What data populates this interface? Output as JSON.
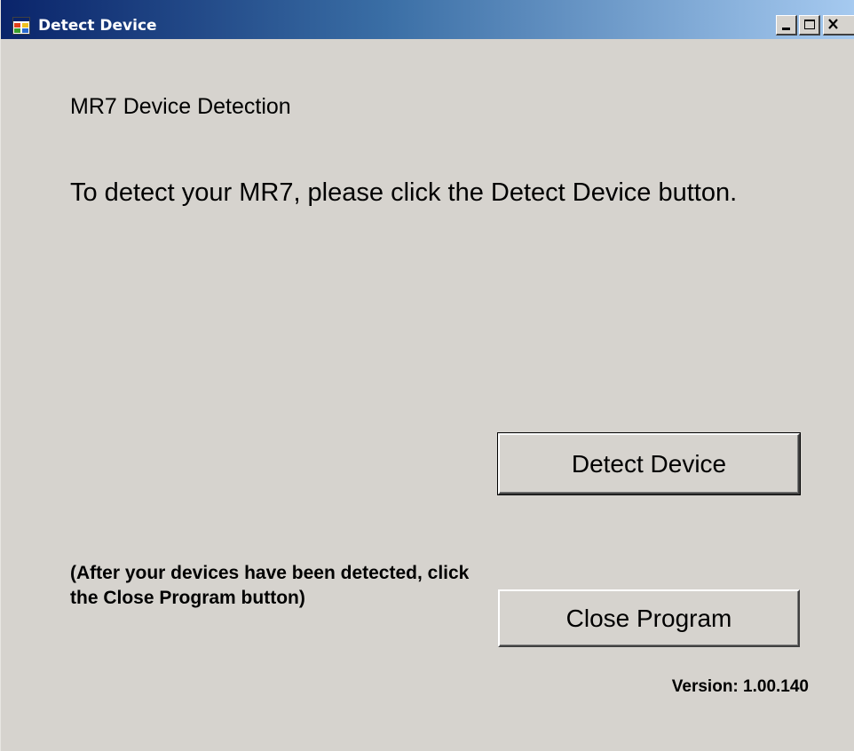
{
  "window": {
    "title": "Detect Device",
    "icon": "application-window-icon",
    "controls": {
      "minimize": "minimize-icon",
      "maximize": "maximize-icon",
      "close": "close-icon"
    }
  },
  "main": {
    "heading": "MR7 Device Detection",
    "instructions": "To detect your MR7, please click the Detect Device button.",
    "detect_button_label": "Detect Device",
    "note": "(After your devices have been detected, click the Close Program button)",
    "close_button_label": "Close Program",
    "version": "Version: 1.00.140"
  },
  "colors": {
    "window_background": "#d6d3ce",
    "titlebar_start": "#0a246a",
    "titlebar_end": "#a6caf0",
    "text": "#000000",
    "title_text": "#ffffff"
  }
}
